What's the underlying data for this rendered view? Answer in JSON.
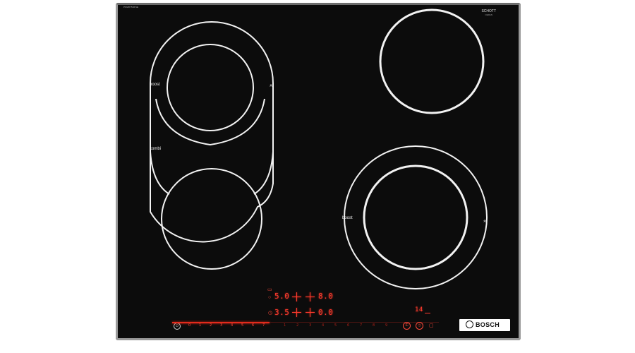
{
  "appliance": {
    "model_number": "PKM875DP1E",
    "glass_brand_line1": "SCHOTT",
    "glass_brand_line2": "CERAN",
    "brand": "BOSCH"
  },
  "zones": {
    "left_label_boost": "boost",
    "left_label_combi": "combi",
    "right_label_boost": "boost",
    "chevron_glyph": "»"
  },
  "display": {
    "rear_left_level": "5.0",
    "rear_right_level": "8.0",
    "front_left_level": "3.5",
    "front_right_level": "0.0",
    "timer_value": "14",
    "indicator_color": "#ff3b2f"
  },
  "slider": {
    "scale_labels": [
      "0",
      "1",
      "2",
      "3",
      "4",
      "5",
      "6",
      "7",
      "8",
      "9"
    ],
    "scale_labels_right": [
      "1",
      "2",
      "3",
      "4",
      "5",
      "6",
      "7",
      "8",
      "9"
    ],
    "power_icon": "power-icon",
    "lock_icon": "child-lock-icon",
    "timer_icon": "timer-icon"
  },
  "colors": {
    "glass": "#0c0c0c",
    "frame": "#9a9a9a",
    "zone_line": "#f2f2f2",
    "touch_red": "#e32a1c"
  }
}
